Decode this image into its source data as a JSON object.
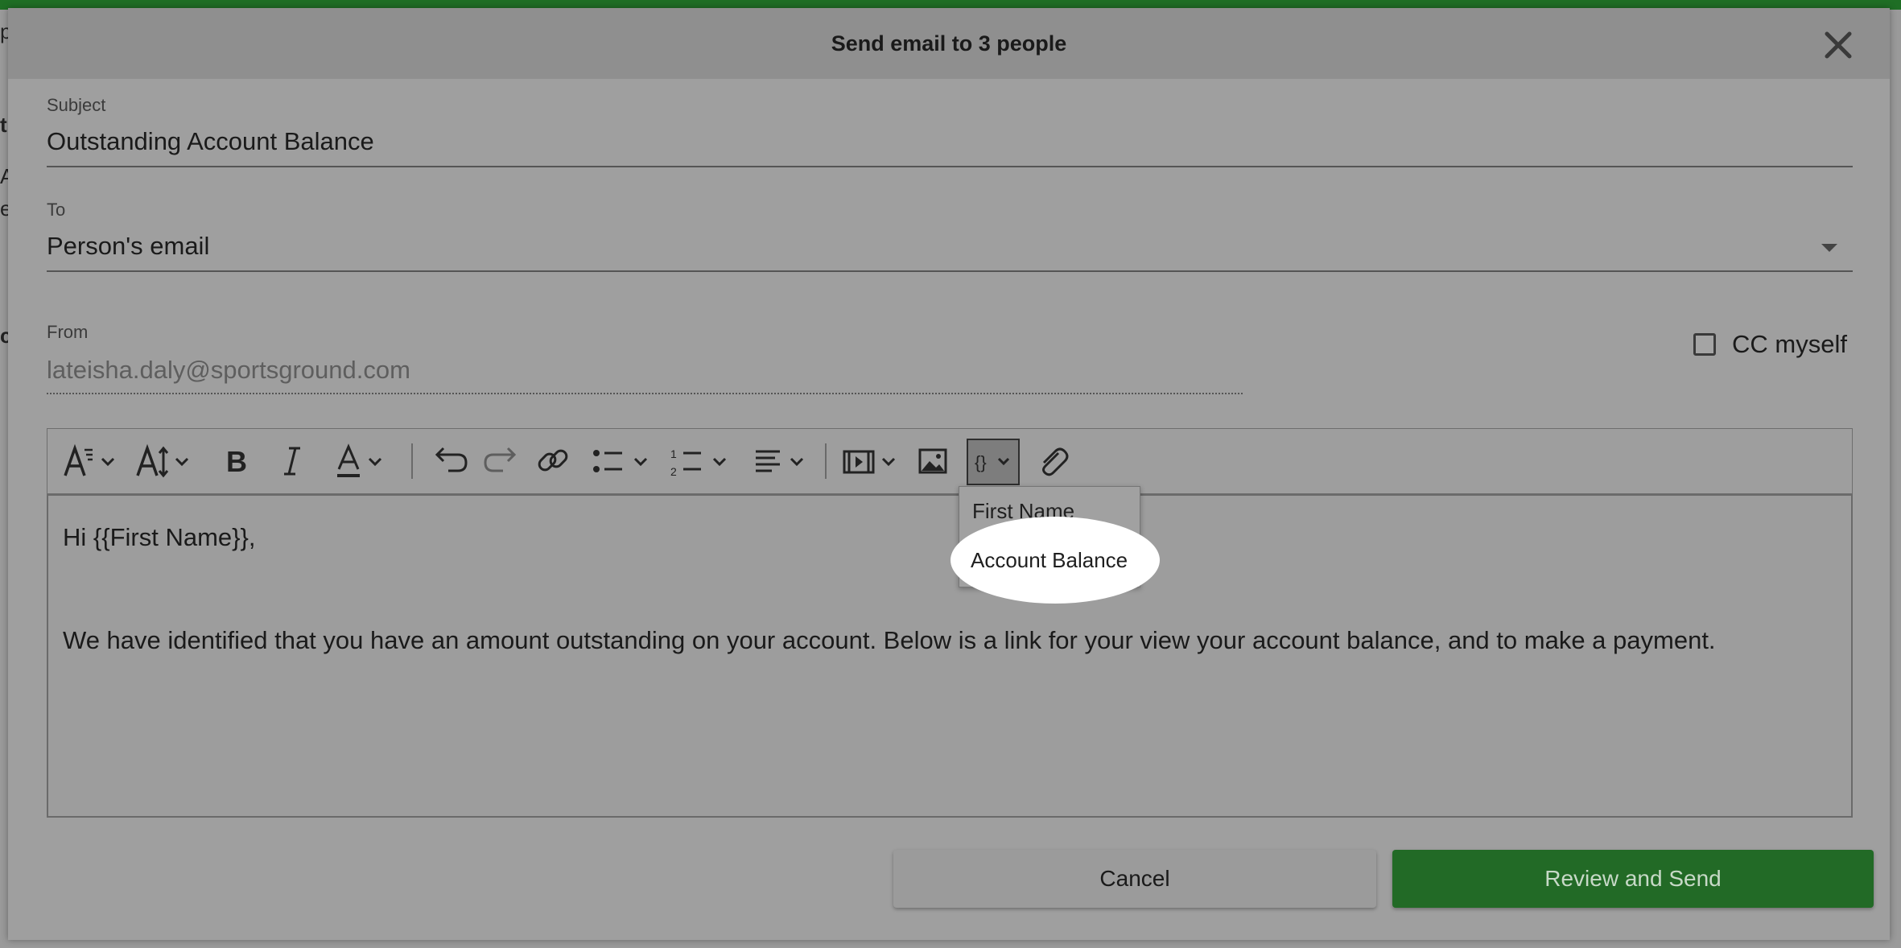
{
  "dialog": {
    "title": "Send email to 3 people",
    "close_icon": "close-icon"
  },
  "subject": {
    "label": "Subject",
    "value": "Outstanding Account Balance"
  },
  "to": {
    "label": "To",
    "value": "Person's email",
    "icon": "caret-down-icon"
  },
  "from": {
    "label": "From",
    "value": "lateisha.daly@sportsground.com"
  },
  "cc_myself": {
    "label": "CC myself",
    "checked": false
  },
  "toolbar": {
    "icons": [
      "font-style-icon",
      "font-size-icon",
      "bold-icon",
      "italic-icon",
      "text-color-icon",
      "undo-icon",
      "redo-icon",
      "link-icon",
      "bulleted-list-icon",
      "numbered-list-icon",
      "align-icon",
      "video-icon",
      "image-icon",
      "merge-field-icon",
      "attachment-icon"
    ]
  },
  "merge_menu": {
    "items": [
      "First Name",
      "Account Balance"
    ],
    "highlighted": "Account Balance"
  },
  "body": {
    "line1": "Hi {{First Name}},",
    "line2": "We have identified that you have an amount outstanding on your account. Below is a link for your view your account balance, and to make a payment."
  },
  "buttons": {
    "cancel": "Cancel",
    "send": "Review and Send"
  },
  "background_fragments": [
    "p",
    "t",
    "A",
    "e",
    "c"
  ],
  "colors": {
    "primary_button": "#226a26",
    "overlay": "#9f9f9f"
  }
}
